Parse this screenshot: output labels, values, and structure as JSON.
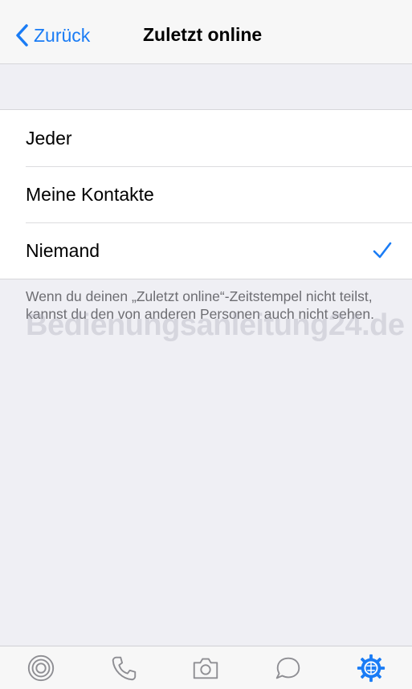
{
  "navbar": {
    "back_label": "Zurück",
    "title": "Zuletzt online"
  },
  "options": [
    {
      "label": "Jeder",
      "selected": false
    },
    {
      "label": "Meine Kontakte",
      "selected": false
    },
    {
      "label": "Niemand",
      "selected": true
    }
  ],
  "footer_text": "Wenn du deinen „Zuletzt online“-Zeitstempel nicht teilst, kannst du den von anderen Personen auch nicht sehen.",
  "watermark": "Bedienungsanleitung24.de",
  "tabbar": {
    "tabs": [
      {
        "icon": "status-icon"
      },
      {
        "icon": "phone-icon"
      },
      {
        "icon": "camera-icon"
      },
      {
        "icon": "chats-icon"
      },
      {
        "icon": "settings-icon",
        "active": true
      }
    ]
  },
  "colors": {
    "accent": "#1a7cf5",
    "background": "#efeff4",
    "footer_text": "#6d6d72"
  }
}
